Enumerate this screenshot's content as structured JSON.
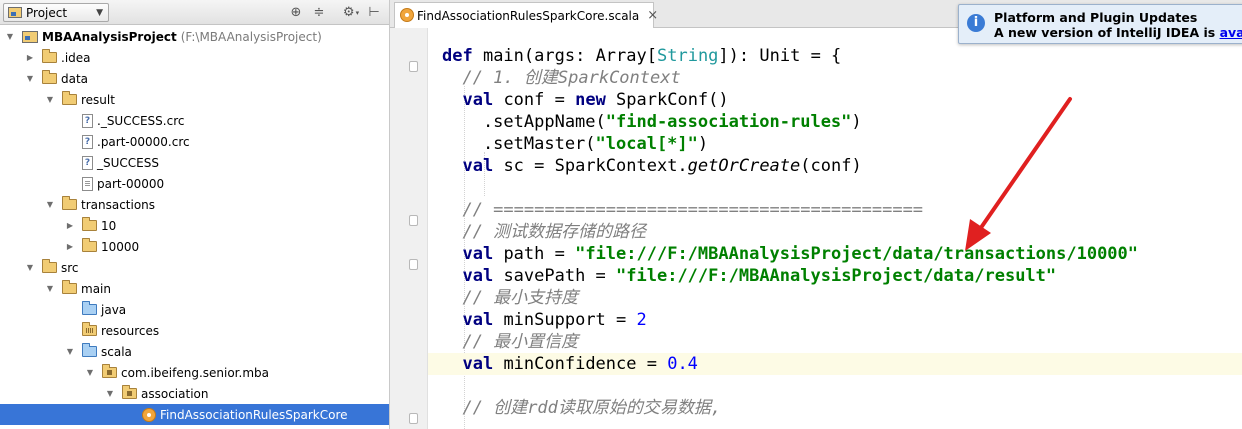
{
  "project_panel": {
    "view_selector": "Project",
    "toolbar_icons": [
      "scroll-from-source-icon",
      "collapse-all-icon",
      "settings-gear-icon",
      "hide-panel-icon"
    ],
    "tree": [
      {
        "level": 0,
        "label": "MBAAnalysisProject",
        "hint": "(F:\\MBAAnalysisProject)",
        "icon": "project-folder-icon",
        "toggle": "expanded",
        "bold": true
      },
      {
        "level": 1,
        "label": ".idea",
        "icon": "folder-icon",
        "toggle": "collapsed"
      },
      {
        "level": 1,
        "label": "data",
        "icon": "folder-icon",
        "toggle": "expanded"
      },
      {
        "level": 2,
        "label": "result",
        "icon": "folder-icon",
        "toggle": "expanded"
      },
      {
        "level": 3,
        "label": "._SUCCESS.crc",
        "icon": "unknown-file-icon",
        "toggle": "none"
      },
      {
        "level": 3,
        "label": ".part-00000.crc",
        "icon": "unknown-file-icon",
        "toggle": "none"
      },
      {
        "level": 3,
        "label": "_SUCCESS",
        "icon": "unknown-file-icon",
        "toggle": "none"
      },
      {
        "level": 3,
        "label": "part-00000",
        "icon": "text-file-icon",
        "toggle": "none"
      },
      {
        "level": 2,
        "label": "transactions",
        "icon": "folder-icon",
        "toggle": "expanded"
      },
      {
        "level": 3,
        "label": "10",
        "icon": "folder-icon",
        "toggle": "collapsed"
      },
      {
        "level": 3,
        "label": "10000",
        "icon": "folder-icon",
        "toggle": "collapsed"
      },
      {
        "level": 1,
        "label": "src",
        "icon": "folder-icon",
        "toggle": "expanded"
      },
      {
        "level": 2,
        "label": "main",
        "icon": "folder-icon",
        "toggle": "expanded"
      },
      {
        "level": 3,
        "label": "java",
        "icon": "source-folder-icon",
        "toggle": "none"
      },
      {
        "level": 3,
        "label": "resources",
        "icon": "resources-folder-icon",
        "toggle": "none"
      },
      {
        "level": 3,
        "label": "scala",
        "icon": "source-folder-icon",
        "toggle": "expanded"
      },
      {
        "level": 4,
        "label": "com.ibeifeng.senior.mba",
        "icon": "package-icon",
        "toggle": "expanded"
      },
      {
        "level": 5,
        "label": "association",
        "icon": "package-icon",
        "toggle": "expanded"
      },
      {
        "level": 6,
        "label": "FindAssociationRulesSparkCore",
        "icon": "scala-object-icon",
        "toggle": "none",
        "selected": true
      }
    ]
  },
  "editor": {
    "tab_label": "FindAssociationRulesSparkCore.scala",
    "lines": [
      [],
      [
        {
          "t": "def ",
          "c": "kw"
        },
        {
          "t": "main",
          "c": ""
        },
        {
          "t": "(args: ",
          "c": ""
        },
        {
          "t": "Array",
          "c": ""
        },
        {
          "t": "[",
          "c": ""
        },
        {
          "t": "String",
          "c": "ty"
        },
        {
          "t": "]): ",
          "c": ""
        },
        {
          "t": "Unit",
          "c": ""
        },
        {
          "t": " = {",
          "c": ""
        }
      ],
      [
        {
          "t": "  // 1. 创建",
          "c": "cm"
        },
        {
          "t": "SparkContext",
          "c": "cm"
        }
      ],
      [
        {
          "t": "  ",
          "c": ""
        },
        {
          "t": "val ",
          "c": "kw"
        },
        {
          "t": "conf = ",
          "c": ""
        },
        {
          "t": "new ",
          "c": "kw"
        },
        {
          "t": "SparkConf()",
          "c": ""
        }
      ],
      [
        {
          "t": "    .setAppName(",
          "c": ""
        },
        {
          "t": "\"find-association-rules\"",
          "c": "st"
        },
        {
          "t": ")",
          "c": ""
        }
      ],
      [
        {
          "t": "    .setMaster(",
          "c": ""
        },
        {
          "t": "\"local[*]\"",
          "c": "st"
        },
        {
          "t": ")",
          "c": ""
        }
      ],
      [
        {
          "t": "  ",
          "c": ""
        },
        {
          "t": "val ",
          "c": "kw"
        },
        {
          "t": "sc = SparkContext.",
          "c": ""
        },
        {
          "t": "getOrCreate",
          "c": "it"
        },
        {
          "t": "(conf)",
          "c": ""
        }
      ],
      [],
      [
        {
          "t": "  // ==========================================",
          "c": "cm"
        }
      ],
      [
        {
          "t": "  // 测试数据存储的路径",
          "c": "cm"
        }
      ],
      [
        {
          "t": "  ",
          "c": ""
        },
        {
          "t": "val ",
          "c": "kw"
        },
        {
          "t": "path = ",
          "c": ""
        },
        {
          "t": "\"file:///F:/MBAAnalysisProject/data/transactions/10000\"",
          "c": "st"
        }
      ],
      [
        {
          "t": "  ",
          "c": ""
        },
        {
          "t": "val ",
          "c": "kw"
        },
        {
          "t": "savePath = ",
          "c": ""
        },
        {
          "t": "\"file:///F:/MBAAnalysisProject/data/result\"",
          "c": "st"
        }
      ],
      [
        {
          "t": "  // 最小支持度",
          "c": "cm"
        }
      ],
      [
        {
          "t": "  ",
          "c": ""
        },
        {
          "t": "val ",
          "c": "kw"
        },
        {
          "t": "minSupport = ",
          "c": ""
        },
        {
          "t": "2",
          "c": "num"
        }
      ],
      [
        {
          "t": "  // 最小置信度",
          "c": "cm"
        }
      ],
      [
        {
          "t": "  ",
          "c": ""
        },
        {
          "t": "val ",
          "c": "kw"
        },
        {
          "t": "minConfidence = ",
          "c": ""
        },
        {
          "t": "0.4",
          "c": "num"
        }
      ],
      [],
      [
        {
          "t": "  // 创建",
          "c": "cm"
        },
        {
          "t": "rdd",
          "c": "cm"
        },
        {
          "t": "读取原始的交易数据,",
          "c": "cm"
        }
      ]
    ],
    "highlighted_line": 15
  },
  "notification": {
    "title": "Platform and Plugin Updates",
    "message": "A new version of IntelliJ IDEA is ",
    "link": "available",
    "icon": "info-icon"
  },
  "annotation": {
    "type": "red-arrow",
    "color": "#e02020",
    "points_to": "file:///F:/MBAAnalysisProject/data/transactions/10000"
  },
  "colors": {
    "selection": "#3875d7",
    "keyword": "#000080",
    "string": "#008000",
    "comment": "#808080",
    "number": "#0000ff",
    "current_line": "#fdfbe5"
  }
}
